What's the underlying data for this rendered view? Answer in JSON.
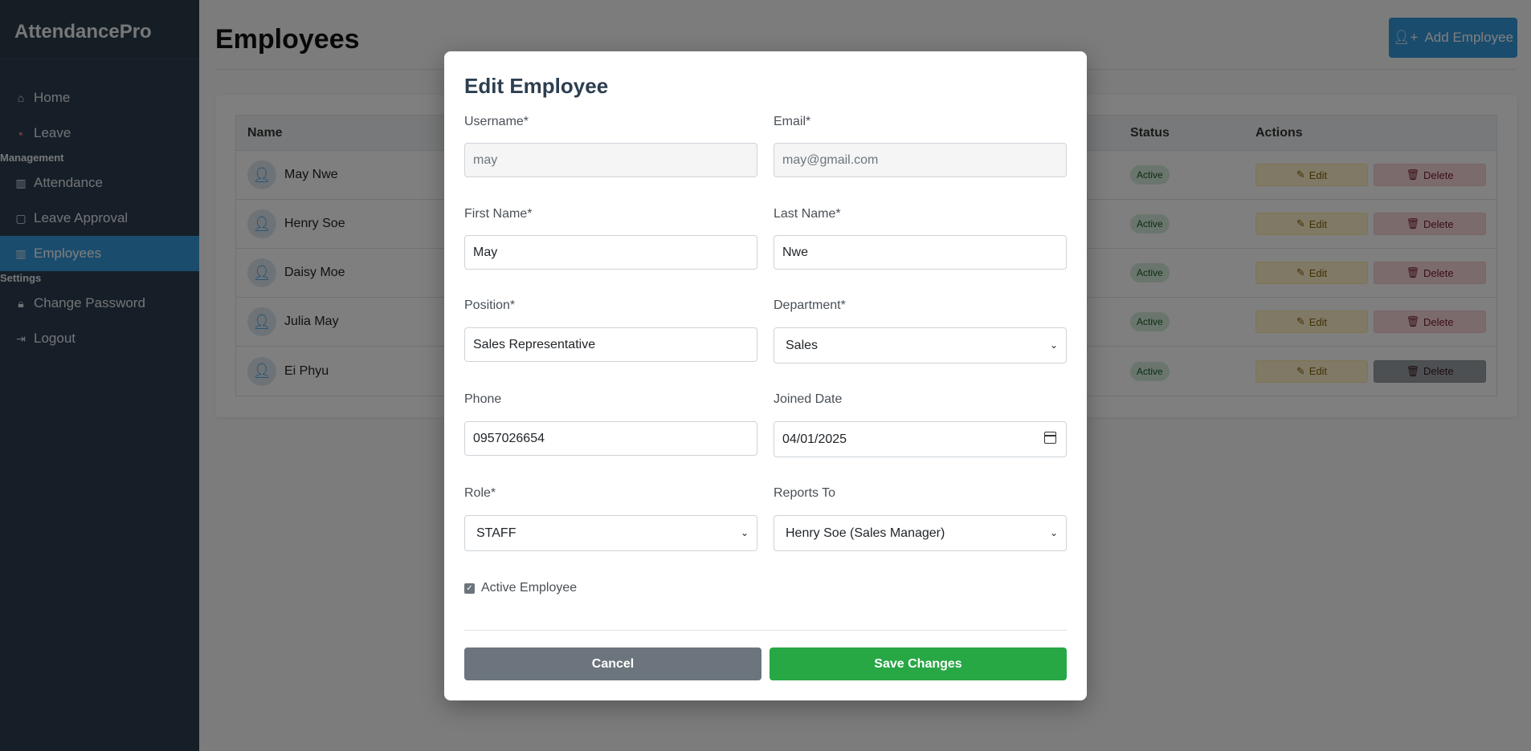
{
  "app": {
    "brand": "AttendancePro"
  },
  "sidebar": {
    "items_top": [
      {
        "label": "Home",
        "icon": "home-icon"
      },
      {
        "label": "Leave",
        "icon": "calendar-icon"
      }
    ],
    "section_management": "Management",
    "items_management": [
      {
        "label": "Attendance",
        "icon": "chart-icon"
      },
      {
        "label": "Leave Approval",
        "icon": "calendar-check-icon"
      },
      {
        "label": "Employees",
        "icon": "chart-icon",
        "active": true
      }
    ],
    "section_settings": "Settings",
    "items_settings": [
      {
        "label": "Change Password",
        "icon": "lock-icon"
      },
      {
        "label": "Logout",
        "icon": "logout-icon"
      }
    ]
  },
  "page": {
    "title": "Employees",
    "add_button": "Add Employee"
  },
  "table": {
    "headers": {
      "name": "Name",
      "status": "Status",
      "actions": "Actions"
    },
    "rows": [
      {
        "name": "May Nwe",
        "status": "Active"
      },
      {
        "name": "Henry Soe",
        "status": "Active"
      },
      {
        "name": "Daisy Moe",
        "status": "Active"
      },
      {
        "name": "Julia May",
        "status": "Active"
      },
      {
        "name": "Ei Phyu",
        "status": "Active"
      }
    ],
    "edit_label": "Edit",
    "delete_label": "Delete"
  },
  "modal": {
    "title": "Edit Employee",
    "username_label": "Username*",
    "username_value": "may",
    "email_label": "Email*",
    "email_value": "may@gmail.com",
    "first_name_label": "First Name*",
    "first_name_value": "May",
    "last_name_label": "Last Name*",
    "last_name_value": "Nwe",
    "position_label": "Position*",
    "position_value": "Sales Representative",
    "department_label": "Department*",
    "department_value": "Sales",
    "phone_label": "Phone",
    "phone_value": "0957026654",
    "joined_label": "Joined Date",
    "joined_value": "04/01/2025",
    "role_label": "Role*",
    "role_value": "STAFF",
    "reports_label": "Reports To",
    "reports_value": "Henry Soe (Sales Manager)",
    "active_label": "Active Employee",
    "active_checked": true,
    "cancel_label": "Cancel",
    "save_label": "Save Changes"
  },
  "colors": {
    "sidebar_bg": "#2c3e50",
    "accent": "#3498db",
    "save": "#28a745",
    "cancel": "#6c757d"
  }
}
